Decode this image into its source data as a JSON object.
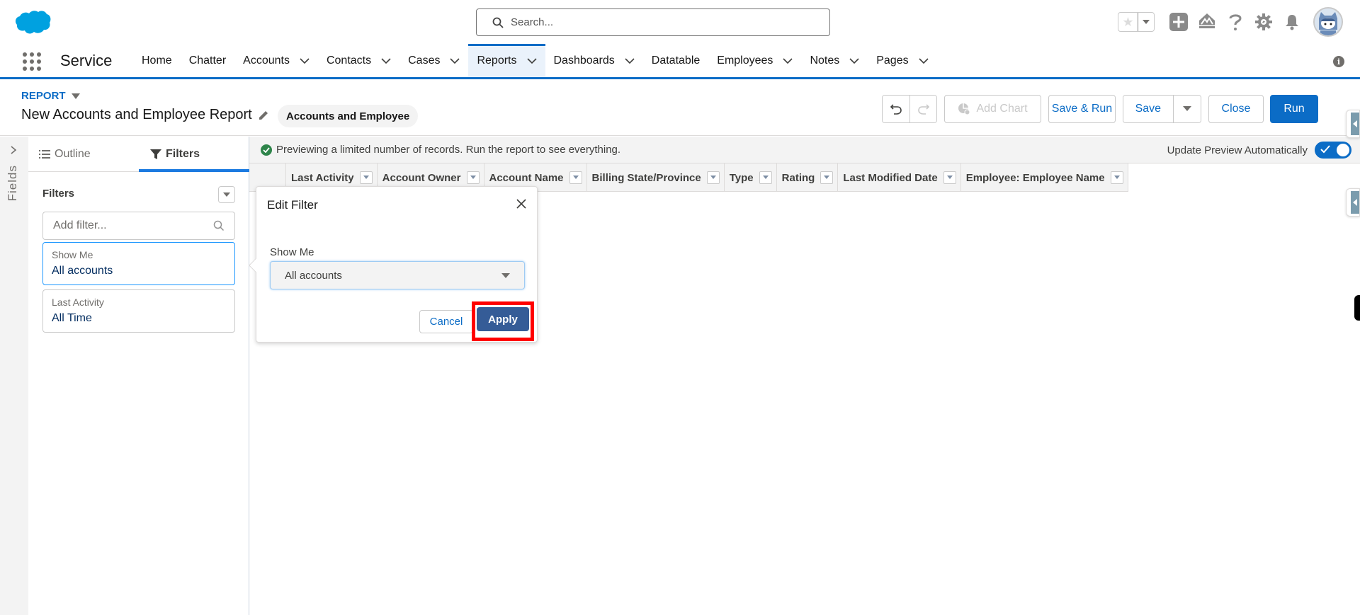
{
  "global_header": {
    "search_placeholder": "Search...",
    "icons": [
      "favorites-star-icon",
      "favorites-dropdown-icon",
      "global-actions-plus-icon",
      "trailhead-icon",
      "help-icon",
      "setup-gear-icon",
      "notifications-bell-icon",
      "user-avatar"
    ]
  },
  "app_nav": {
    "app_name": "Service",
    "items": [
      {
        "label": "Home",
        "has_menu": false,
        "active": false
      },
      {
        "label": "Chatter",
        "has_menu": false,
        "active": false
      },
      {
        "label": "Accounts",
        "has_menu": true,
        "active": false
      },
      {
        "label": "Contacts",
        "has_menu": true,
        "active": false
      },
      {
        "label": "Cases",
        "has_menu": true,
        "active": false
      },
      {
        "label": "Reports",
        "has_menu": true,
        "active": true
      },
      {
        "label": "Dashboards",
        "has_menu": true,
        "active": false
      },
      {
        "label": "Datatable",
        "has_menu": false,
        "active": false
      },
      {
        "label": "Employees",
        "has_menu": true,
        "active": false
      },
      {
        "label": "Notes",
        "has_menu": true,
        "active": false
      },
      {
        "label": "Pages",
        "has_menu": true,
        "active": false
      }
    ],
    "info_icon_glyph": "i"
  },
  "report_header": {
    "object_label": "REPORT",
    "title": "New Accounts and Employee Report",
    "report_type": "Accounts and Employee",
    "buttons": {
      "add_chart": "Add Chart",
      "save_and_run": "Save & Run",
      "save": "Save",
      "close": "Close",
      "run": "Run"
    }
  },
  "left_rail": {
    "fields_label": "Fields"
  },
  "filters_panel": {
    "tabs": [
      {
        "label": "Outline",
        "active": false
      },
      {
        "label": "Filters",
        "active": true
      }
    ],
    "heading": "Filters",
    "add_filter_placeholder": "Add filter...",
    "filters": [
      {
        "label": "Show Me",
        "value": "All accounts",
        "selected": true
      },
      {
        "label": "Last Activity",
        "value": "All Time",
        "selected": false
      }
    ]
  },
  "preview": {
    "banner_text": "Previewing a limited number of records. Run the report to see everything.",
    "auto_update_label": "Update Preview Automatically",
    "auto_update_on": true,
    "columns": [
      "Last Activity",
      "Account Owner",
      "Account Name",
      "Billing State/Province",
      "Type",
      "Rating",
      "Last Modified Date",
      "Employee: Employee Name"
    ]
  },
  "edit_filter_popover": {
    "title": "Edit Filter",
    "field_label": "Show Me",
    "selected_value": "All accounts",
    "cancel_label": "Cancel",
    "apply_label": "Apply"
  },
  "colors": {
    "brand_blue": "#0b6cc6",
    "apply_button": "#355c97",
    "highlight_red": "#ff0000",
    "success_green": "#2e844a"
  }
}
